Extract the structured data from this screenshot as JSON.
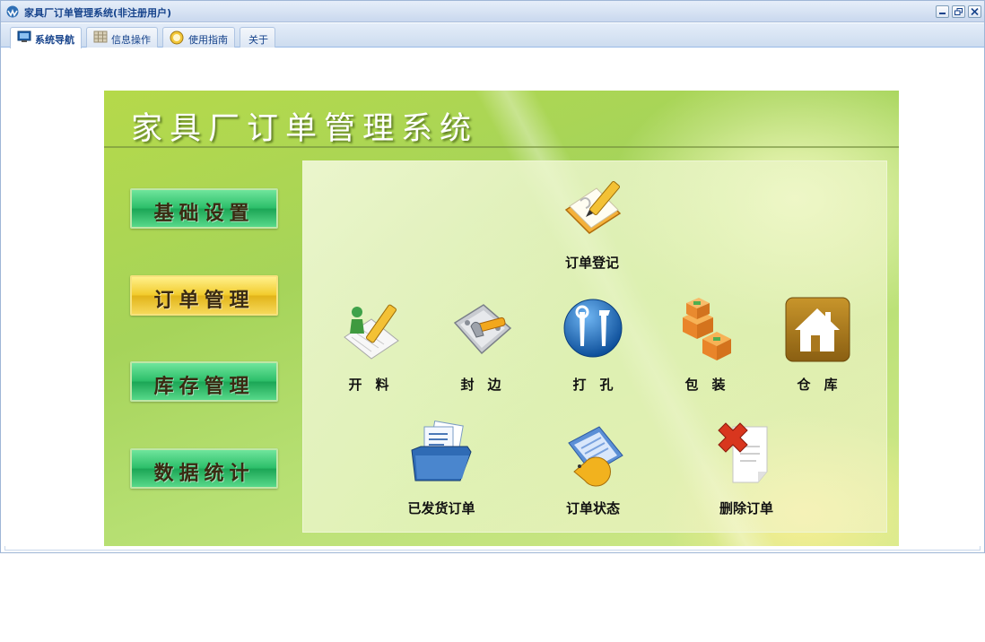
{
  "window": {
    "title": "家具厂订单管理系统(非注册用户)"
  },
  "tabs": [
    {
      "label": "系统导航",
      "icon": "monitor-icon",
      "active": true
    },
    {
      "label": "信息操作",
      "icon": "grid-icon",
      "active": false
    },
    {
      "label": "使用指南",
      "icon": "help-icon",
      "active": false
    },
    {
      "label": "关于",
      "icon": "",
      "active": false
    }
  ],
  "panel": {
    "title": "家具厂订单管理系统",
    "nav": [
      {
        "label": "基础设置",
        "selected": false
      },
      {
        "label": "订单管理",
        "selected": true
      },
      {
        "label": "库存管理",
        "selected": false
      },
      {
        "label": "数据统计",
        "selected": false
      }
    ],
    "functions": {
      "register": {
        "label": "订单登记",
        "icon": "notebook-pencil-icon"
      },
      "cutting": {
        "label": "开　料",
        "icon": "document-pencil-icon"
      },
      "edging": {
        "label": "封　边",
        "icon": "tool-box-icon"
      },
      "drilling": {
        "label": "打　孔",
        "icon": "tools-globe-icon"
      },
      "packing": {
        "label": "包　装",
        "icon": "boxes-icon"
      },
      "warehouse": {
        "label": "仓　库",
        "icon": "house-icon"
      },
      "shipped": {
        "label": "已发货订单",
        "icon": "folder-documents-icon"
      },
      "status": {
        "label": "订单状态",
        "icon": "chart-document-icon"
      },
      "delete": {
        "label": "删除订单",
        "icon": "delete-document-icon"
      }
    }
  },
  "colors": {
    "titlebar_text": "#15428b",
    "nav_green": "#2dbf6a",
    "nav_selected_gold": "#f2cc2e",
    "panel_green": "#a6d45a"
  }
}
